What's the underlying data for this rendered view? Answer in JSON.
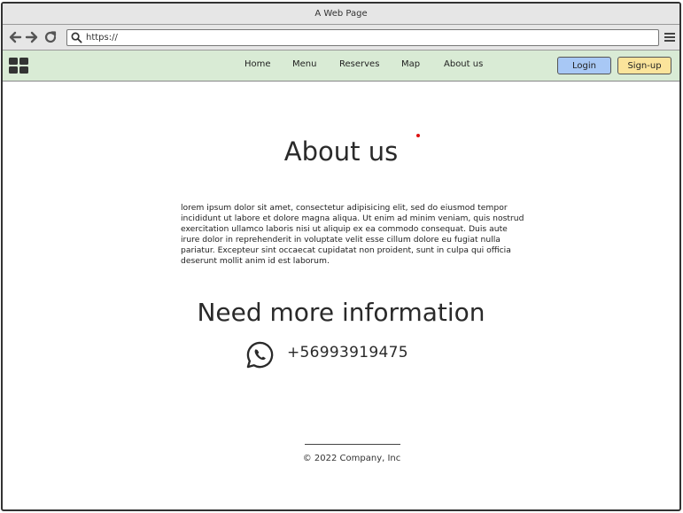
{
  "window": {
    "title": "A Web Page"
  },
  "browser": {
    "url": "https://",
    "icons": {
      "back": "arrow-left-icon",
      "forward": "arrow-right-icon",
      "reload": "reload-icon",
      "search": "search-icon",
      "menu": "hamburger-icon"
    }
  },
  "nav": {
    "bg_color": "#d9ebd5",
    "logo_icon": "grid-logo-icon",
    "links": [
      "Home",
      "Menu",
      "Reserves",
      "Map",
      "About us"
    ],
    "login_label": "Login",
    "signup_label": "Sign-up",
    "login_color": "#a8c8f5",
    "signup_color": "#fbe49b"
  },
  "main": {
    "heading": "About us",
    "body": "lorem ipsum dolor sit amet, consectetur adipisicing elit, sed do eiusmod tempor incididunt ut labore et dolore magna aliqua. Ut enim ad minim veniam, quis nostrud exercitation ullamco laboris nisi ut aliquip ex ea commodo consequat. Duis aute irure dolor in reprehenderit in voluptate velit esse cillum dolore eu fugiat nulla pariatur. Excepteur sint occaecat cupidatat non proident, sunt in culpa qui officia deserunt mollit anim id est laborum.",
    "info_heading": "Need more information",
    "phone_icon": "whatsapp-icon",
    "phone": "+56993919475"
  },
  "footer": {
    "text": "© 2022 Company, Inc"
  }
}
